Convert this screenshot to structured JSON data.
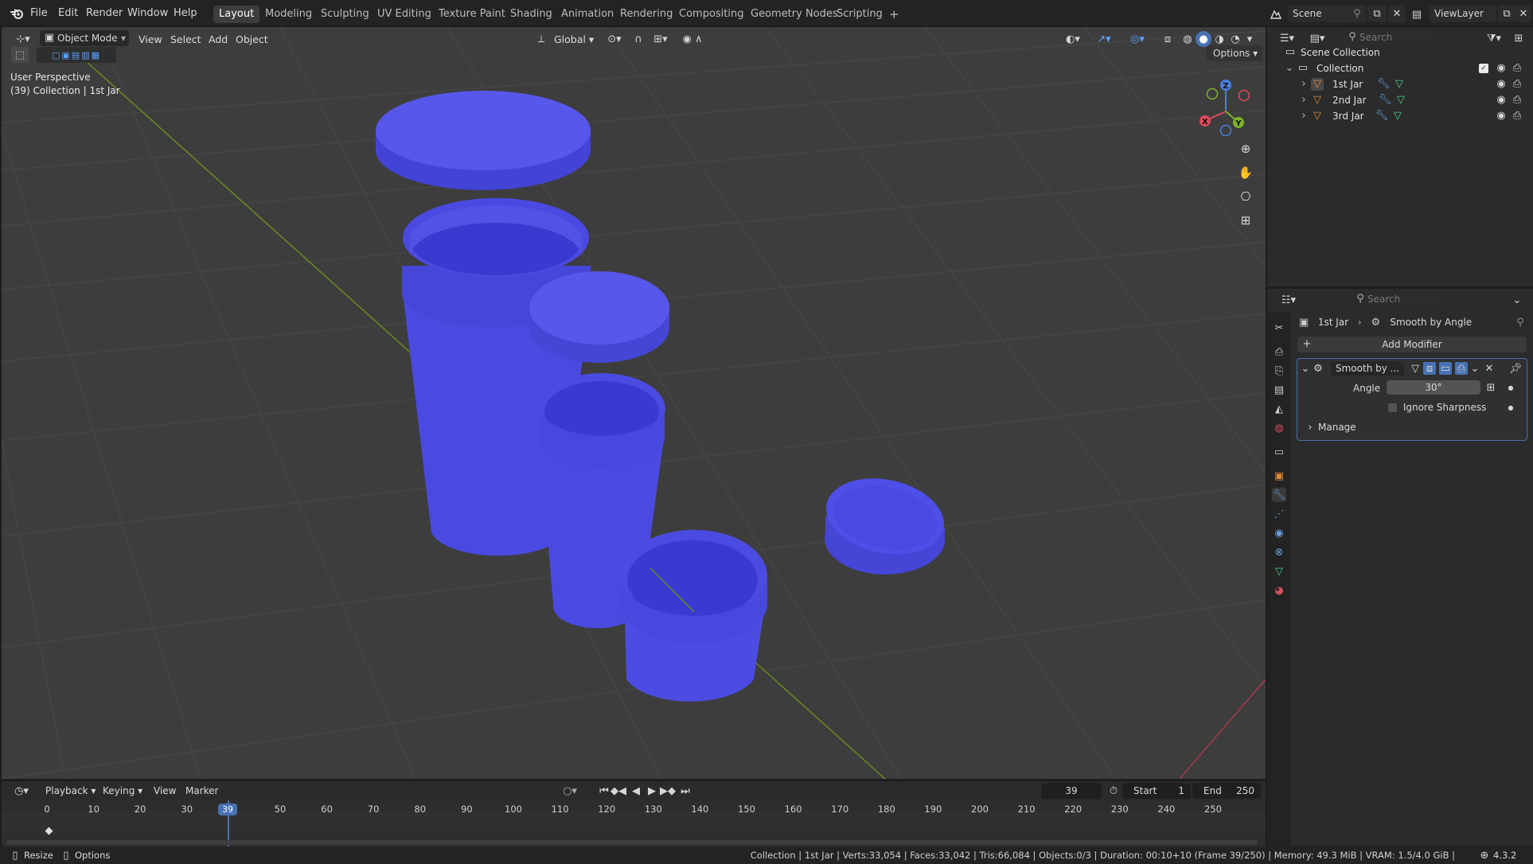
{
  "topbar": {
    "menus": [
      "File",
      "Edit",
      "Render",
      "Window",
      "Help"
    ],
    "workspaces": [
      "Layout",
      "Modeling",
      "Sculpting",
      "UV Editing",
      "Texture Paint",
      "Shading",
      "Animation",
      "Rendering",
      "Compositing",
      "Geometry Nodes",
      "Scripting"
    ],
    "active_workspace": "Layout",
    "add_tab": "+",
    "scene": "Scene",
    "view_layer": "ViewLayer"
  },
  "viewport": {
    "mode": "Object Mode",
    "menus": [
      "View",
      "Select",
      "Add",
      "Object"
    ],
    "transform_orientation": "Global",
    "options": "Options",
    "overlay_title": "User Perspective",
    "overlay_subtitle": "(39) Collection | 1st Jar",
    "gizmo": {
      "z": "Z",
      "x": "X",
      "y": "Y"
    },
    "colors": {
      "jar": "#4f4fe8",
      "background": "#3d3d3d",
      "grid": "#474747",
      "x_axis": "#a63a48",
      "y_axis": "#6b8a23"
    }
  },
  "outliner": {
    "search_placeholder": "Search",
    "scene_collection": "Scene Collection",
    "collection": "Collection",
    "items": [
      {
        "name": "1st Jar"
      },
      {
        "name": "2nd Jar"
      },
      {
        "name": "3rd Jar"
      }
    ]
  },
  "properties": {
    "search_placeholder": "Search",
    "breadcrumb_object": "1st Jar",
    "breadcrumb_modifier": "Smooth by Angle",
    "add_modifier": "Add Modifier",
    "modifier_name": "Smooth by ...",
    "angle_label": "Angle",
    "angle_value": "30°",
    "ignore_sharpness": "Ignore Sharpness",
    "manage": "Manage"
  },
  "timeline": {
    "menus": [
      "Playback",
      "Keying",
      "View",
      "Marker"
    ],
    "current_frame": "39",
    "start_label": "Start",
    "start_value": "1",
    "end_label": "End",
    "end_value": "250",
    "ticks": [
      "0",
      "10",
      "20",
      "30",
      "50",
      "60",
      "70",
      "80",
      "90",
      "100",
      "110",
      "120",
      "130",
      "140",
      "150",
      "160",
      "170",
      "180",
      "190",
      "200",
      "210",
      "220",
      "230",
      "240",
      "250"
    ]
  },
  "statusbar": {
    "left_resize": "Resize",
    "left_options": "Options",
    "info": "Collection | 1st Jar | Verts:33,054 | Faces:33,042 | Tris:66,084 | Objects:0/3 | Duration: 00:10+10 (Frame 39/250) | Memory: 49.3 MiB | VRAM: 1.5/4.0 GiB |",
    "version": "4.3.2"
  }
}
